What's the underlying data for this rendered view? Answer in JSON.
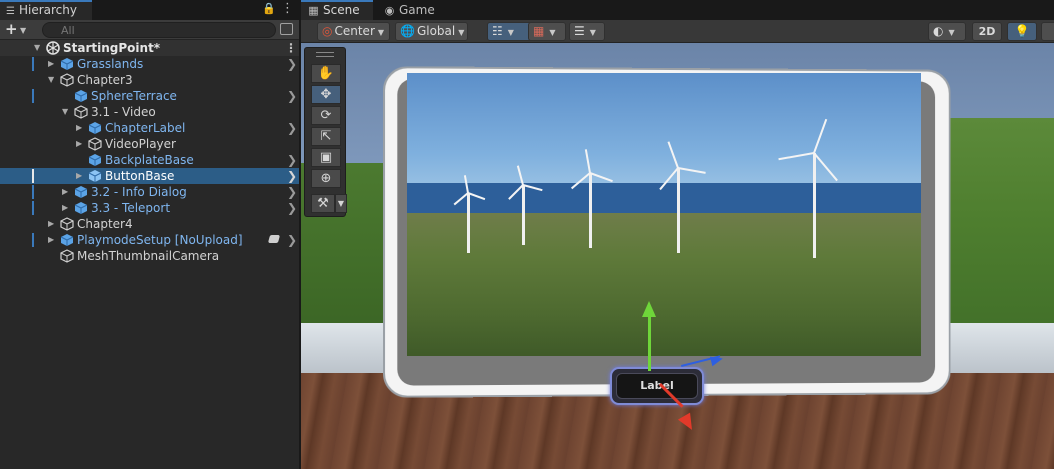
{
  "hierarchy": {
    "tab_title": "Hierarchy",
    "search_placeholder": "All",
    "scene_name": "StartingPoint*",
    "items": [
      {
        "label": "Grasslands"
      },
      {
        "label": "Chapter3"
      },
      {
        "label": "SphereTerrace"
      },
      {
        "label": "3.1 - Video"
      },
      {
        "label": "ChapterLabel"
      },
      {
        "label": "VideoPlayer"
      },
      {
        "label": "BackplateBase"
      },
      {
        "label": "ButtonBase"
      },
      {
        "label": "3.2 - Info Dialog"
      },
      {
        "label": "3.3 - Teleport"
      },
      {
        "label": "Chapter4"
      },
      {
        "label": "PlaymodeSetup [NoUpload]"
      },
      {
        "label": "MeshThumbnailCamera"
      }
    ]
  },
  "scene": {
    "tabs": [
      {
        "label": "Scene"
      },
      {
        "label": "Game"
      }
    ],
    "toolbar": {
      "pivot_label": "Center",
      "space_label": "Global",
      "mode_2d_label": "2D"
    },
    "button_label": "Label"
  },
  "colors": {
    "accent": "#3a79bb",
    "selection": "#2c5d87",
    "prefab_text": "#7fb6f0"
  }
}
